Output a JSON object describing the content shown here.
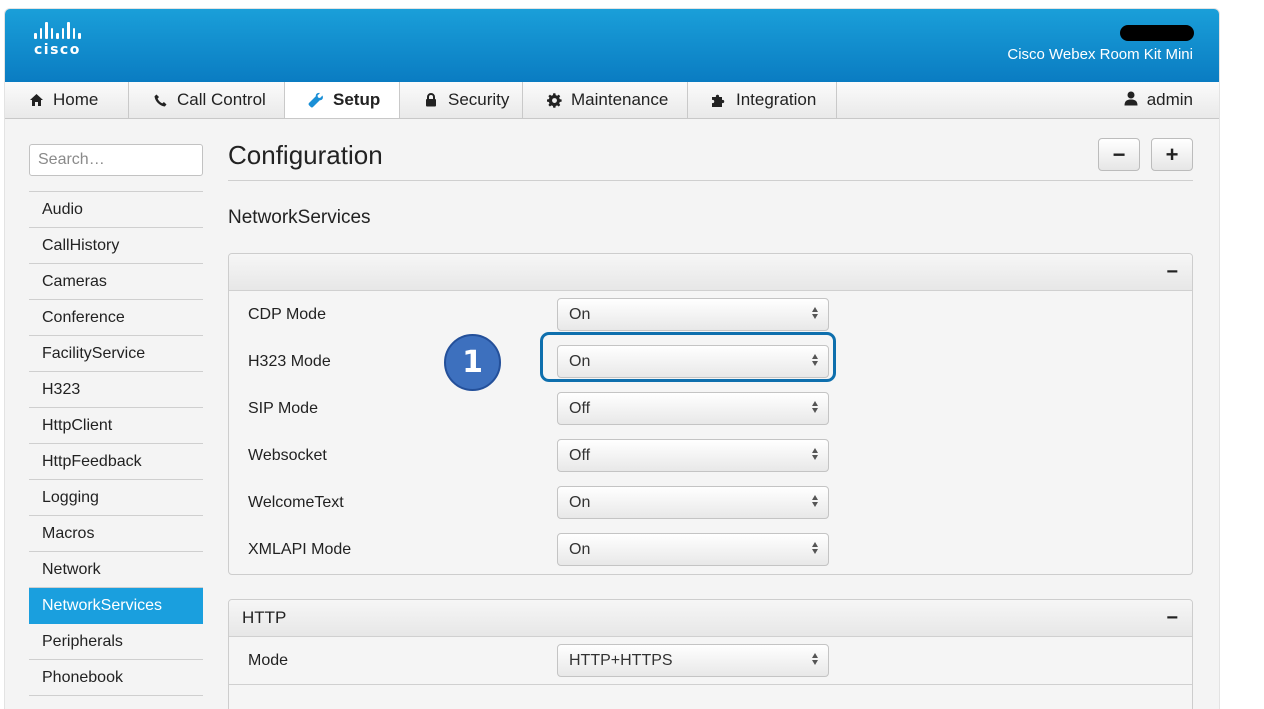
{
  "header": {
    "logo_text": "cisco",
    "product_name": "Cisco Webex Room Kit Mini",
    "brand_color": "#0a7cc2"
  },
  "nav": {
    "tabs": [
      {
        "label": "Home",
        "icon": "home-icon",
        "active": false
      },
      {
        "label": "Call Control",
        "icon": "phone-icon",
        "active": false
      },
      {
        "label": "Setup",
        "icon": "wrench-icon",
        "active": true
      },
      {
        "label": "Security",
        "icon": "lock-icon",
        "active": false
      },
      {
        "label": "Maintenance",
        "icon": "gear-icon",
        "active": false
      },
      {
        "label": "Integration",
        "icon": "puzzle-icon",
        "active": false
      }
    ],
    "user": {
      "label": "admin",
      "icon": "user-icon"
    }
  },
  "sidebar": {
    "search_placeholder": "Search…",
    "items": [
      {
        "label": "Audio"
      },
      {
        "label": "CallHistory"
      },
      {
        "label": "Cameras"
      },
      {
        "label": "Conference"
      },
      {
        "label": "FacilityService"
      },
      {
        "label": "H323"
      },
      {
        "label": "HttpClient"
      },
      {
        "label": "HttpFeedback"
      },
      {
        "label": "Logging"
      },
      {
        "label": "Macros"
      },
      {
        "label": "Network"
      },
      {
        "label": "NetworkServices",
        "active": true
      },
      {
        "label": "Peripherals"
      },
      {
        "label": "Phonebook"
      }
    ],
    "active_color": "#1a9fde"
  },
  "main": {
    "title": "Configuration",
    "collapse_all_label": "−",
    "expand_all_label": "+",
    "section_title": "NetworkServices",
    "panels": [
      {
        "title": "",
        "toggle": "−",
        "rows": [
          {
            "label": "CDP Mode",
            "value": "On"
          },
          {
            "label": "H323 Mode",
            "value": "On"
          },
          {
            "label": "SIP Mode",
            "value": "Off"
          },
          {
            "label": "Websocket",
            "value": "Off"
          },
          {
            "label": "WelcomeText",
            "value": "On"
          },
          {
            "label": "XMLAPI Mode",
            "value": "On"
          }
        ]
      },
      {
        "title": "HTTP",
        "toggle": "−",
        "rows": [
          {
            "label": "Mode",
            "value": "HTTP+HTTPS"
          }
        ]
      }
    ]
  },
  "annotation": {
    "badge_number": "1",
    "highlight_color": "#0e6fad",
    "badge_color": "#3d70be"
  }
}
